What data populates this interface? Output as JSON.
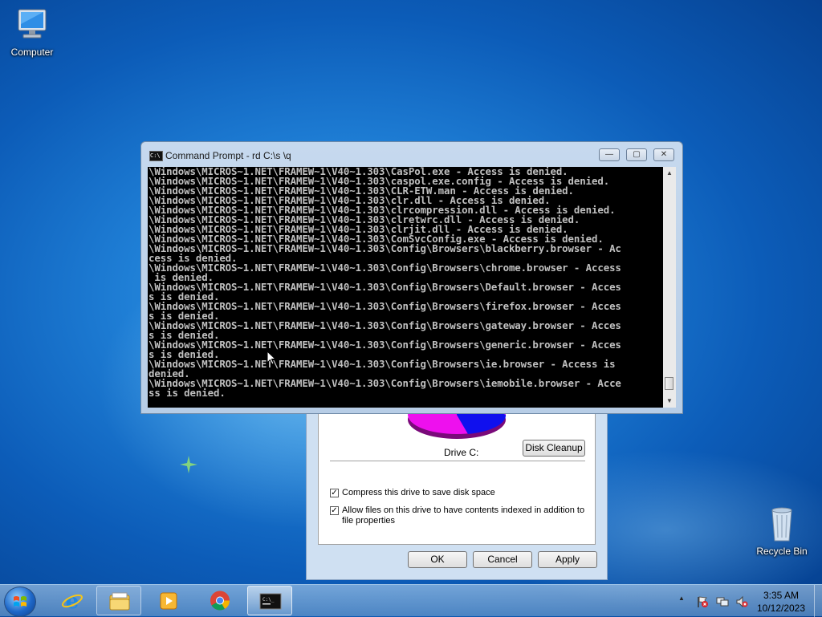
{
  "desktop": {
    "icons": [
      {
        "label": "Computer"
      },
      {
        "label": "Recycle Bin"
      }
    ]
  },
  "properties_dialog": {
    "drive_label": "Drive C:",
    "disk_cleanup_button": "Disk Cleanup",
    "compress_label": "Compress this drive to save disk space",
    "compress_checked": true,
    "index_label_line1": "Allow files on this drive to have contents indexed in addition to",
    "index_label_line2": "file properties",
    "index_checked": true,
    "ok_button": "OK",
    "cancel_button": "Cancel",
    "apply_button": "Apply",
    "pie_colors": {
      "used": "#1010ee",
      "free": "#ee10ee"
    }
  },
  "cmd_window": {
    "title": "Command Prompt - rd  C:\\s \\q",
    "minimize_glyph": "—",
    "maximize_glyph": "▢",
    "close_glyph": "✕",
    "console_lines": [
      "\\Windows\\MICROS~1.NET\\FRAMEW~1\\V40~1.303\\CasPol.exe - Access is denied.",
      "\\Windows\\MICROS~1.NET\\FRAMEW~1\\V40~1.303\\caspol.exe.config - Access is denied.",
      "\\Windows\\MICROS~1.NET\\FRAMEW~1\\V40~1.303\\CLR-ETW.man - Access is denied.",
      "\\Windows\\MICROS~1.NET\\FRAMEW~1\\V40~1.303\\clr.dll - Access is denied.",
      "\\Windows\\MICROS~1.NET\\FRAMEW~1\\V40~1.303\\clrcompression.dll - Access is denied.",
      "\\Windows\\MICROS~1.NET\\FRAMEW~1\\V40~1.303\\clretwrc.dll - Access is denied.",
      "\\Windows\\MICROS~1.NET\\FRAMEW~1\\V40~1.303\\clrjit.dll - Access is denied.",
      "\\Windows\\MICROS~1.NET\\FRAMEW~1\\V40~1.303\\ComSvcConfig.exe - Access is denied.",
      "\\Windows\\MICROS~1.NET\\FRAMEW~1\\V40~1.303\\Config\\Browsers\\blackberry.browser - Ac",
      "cess is denied.",
      "\\Windows\\MICROS~1.NET\\FRAMEW~1\\V40~1.303\\Config\\Browsers\\chrome.browser - Access",
      " is denied.",
      "\\Windows\\MICROS~1.NET\\FRAMEW~1\\V40~1.303\\Config\\Browsers\\Default.browser - Acces",
      "s is denied.",
      "\\Windows\\MICROS~1.NET\\FRAMEW~1\\V40~1.303\\Config\\Browsers\\firefox.browser - Acces",
      "s is denied.",
      "\\Windows\\MICROS~1.NET\\FRAMEW~1\\V40~1.303\\Config\\Browsers\\gateway.browser - Acces",
      "s is denied.",
      "\\Windows\\MICROS~1.NET\\FRAMEW~1\\V40~1.303\\Config\\Browsers\\generic.browser - Acces",
      "s is denied.",
      "\\Windows\\MICROS~1.NET\\FRAMEW~1\\V40~1.303\\Config\\Browsers\\ie.browser - Access is",
      "denied.",
      "\\Windows\\MICROS~1.NET\\FRAMEW~1\\V40~1.303\\Config\\Browsers\\iemobile.browser - Acce",
      "ss is denied."
    ]
  },
  "taskbar": {
    "items": [
      {
        "name": "internet-explorer",
        "state": "pinned"
      },
      {
        "name": "windows-explorer",
        "state": "open"
      },
      {
        "name": "media-player",
        "state": "pinned"
      },
      {
        "name": "chrome",
        "state": "pinned"
      },
      {
        "name": "command-prompt",
        "state": "active"
      }
    ],
    "clock_time": "3:35 AM",
    "clock_date": "10/12/2023",
    "tray_expand_glyph": "▲"
  }
}
